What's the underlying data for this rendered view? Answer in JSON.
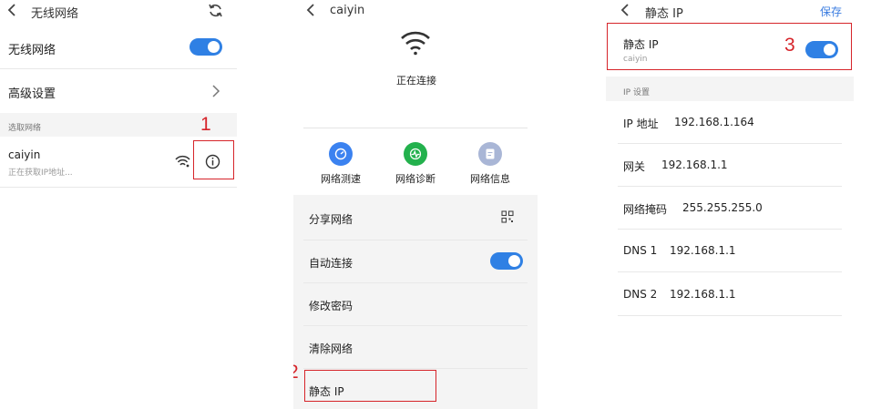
{
  "panel1": {
    "header_title": "无线网络",
    "wifi_label": "无线网络",
    "advanced_label": "高级设置",
    "section_label": "选取网络",
    "network": {
      "name": "caiyin",
      "status": "正在获取IP地址..."
    },
    "marker": "1"
  },
  "panel2": {
    "header_title": "caiyin",
    "connecting": "正在连接",
    "tools": [
      {
        "label": "网络测速",
        "color": "#3b82f0",
        "icon": "speedometer-icon"
      },
      {
        "label": "网络诊断",
        "color": "#23b14d",
        "icon": "pulse-icon"
      },
      {
        "label": "网络信息",
        "color": "#a9b6d6",
        "icon": "document-icon"
      }
    ],
    "menu": [
      "分享网络",
      "自动连接",
      "修改密码",
      "清除网络",
      "静态 IP"
    ],
    "marker": "2"
  },
  "panel3": {
    "header_title": "静态 IP",
    "save_label": "保存",
    "static_ip_label": "静态 IP",
    "network_name": "caiyin",
    "section_label": "IP 设置",
    "fields": [
      {
        "label": "IP 地址",
        "value": "192.168.1.164"
      },
      {
        "label": "网关",
        "value": "192.168.1.1"
      },
      {
        "label": "网络掩码",
        "value": "255.255.255.0"
      },
      {
        "label": "DNS 1",
        "value": "192.168.1.1"
      },
      {
        "label": "DNS 2",
        "value": "192.168.1.1"
      }
    ],
    "marker": "3"
  },
  "colors": {
    "accent": "#2f80e4",
    "annotation": "#d6242a"
  }
}
